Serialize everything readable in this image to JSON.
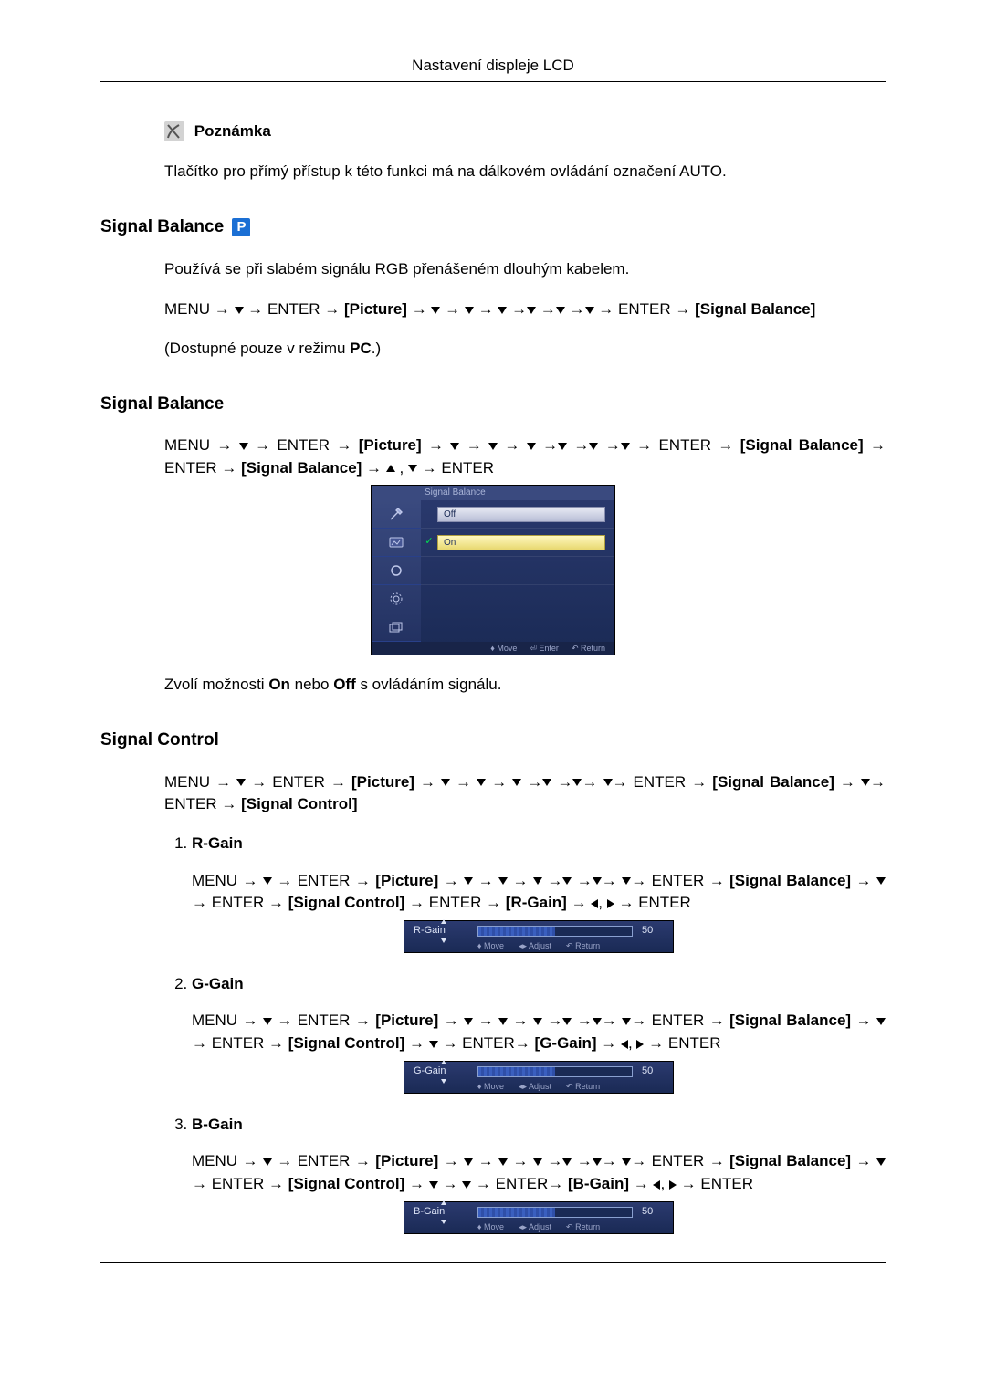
{
  "page_title": "Nastavení displeje LCD",
  "note": {
    "label": "Poznámka",
    "text": "Tlačítko pro přímý přístup k této funkci má na dálkovém ovládání označení AUTO."
  },
  "section1": {
    "heading": "Signal Balance",
    "badge": "P",
    "intro": "Používá se při slabém signálu RGB přenášeném dlouhým kabelem.",
    "path_prefix": "MENU → ",
    "path_enter1": " → ENTER → ",
    "path_picture": "[Picture]",
    "path_mid": " → ",
    "path_enter2": " → ENTER → ",
    "path_sb": "[Signal Balance]",
    "avail_prefix": "(Dostupné pouze v režimu ",
    "avail_mode": "PC",
    "avail_suffix": ".)"
  },
  "section2": {
    "heading": "Signal Balance",
    "path_prefix": "MENU → ",
    "path_enter1": " → ENTER → ",
    "path_picture": "[Picture]",
    "path_mid": " → ",
    "path_enter2": " → ENTER → ",
    "path_sb": "[Signal Balance]",
    "path_after_sb": " → ENTER → ",
    "path_sb2": "[Signal Balance]",
    "path_tail": " → ENTER",
    "osd": {
      "title": "Signal Balance",
      "off": "Off",
      "on": "On",
      "footer_move": "Move",
      "footer_enter": "Enter",
      "footer_return": "Return"
    },
    "desc_prefix": "Zvolí možnosti ",
    "desc_on": "On",
    "desc_mid": " nebo ",
    "desc_off": "Off",
    "desc_suffix": " s ovládáním signálu."
  },
  "section3": {
    "heading": "Signal Control",
    "path_prefix": "MENU → ",
    "path_enter1": " → ENTER → ",
    "path_picture": "[Picture]",
    "path_mid": " → ",
    "path_enter2": " ENTER → ",
    "path_sb": "[Signal Balance]",
    "path_after": " → ",
    "path_enter3": "→ ENTER → ",
    "path_sc": "[Signal Control]",
    "items": [
      {
        "title": "R-Gain",
        "pre": "MENU → ",
        "enter1": " → ENTER → ",
        "picture": "[Picture]",
        "mid": " → ",
        "enter2": " ENTER → ",
        "sb": "[Signal Balance]",
        "after_sb": " → ",
        "enter3": "→ ENTER → ",
        "sc": "[Signal Control]",
        "after_sc": " → ENTER → ",
        "gain": "[R-Gain]",
        "tail": " → ENTER",
        "slider_label": "R-Gain",
        "slider_value": "50",
        "footer_move": "Move",
        "footer_adjust": "Adjust",
        "footer_return": "Return"
      },
      {
        "title": "G-Gain",
        "pre": "MENU → ",
        "enter1": " → ENTER → ",
        "picture": "[Picture]",
        "mid": " → ",
        "enter2": " ENTER → ",
        "sb": "[Signal Balance]",
        "after_sb": " → ",
        "enter3": "→ ENTER → ",
        "sc": "[Signal Control]",
        "after_sc": " → ",
        "enter4": " → ENTER→ ",
        "gain": "[G-Gain]",
        "tail": " → ENTER",
        "slider_label": "G-Gain",
        "slider_value": "50",
        "footer_move": "Move",
        "footer_adjust": "Adjust",
        "footer_return": "Return"
      },
      {
        "title": "B-Gain",
        "pre": "MENU → ",
        "enter1": " → ENTER → ",
        "picture": "[Picture]",
        "mid": " → ",
        "enter2": " ENTER → ",
        "sb": "[Signal Balance]",
        "after_sb": " → ",
        "enter3": "→ ENTER → ",
        "sc": "[Signal Control]",
        "after_sc": " → ",
        "enter4": " → ENTER→ ",
        "gain": "[B-Gain]",
        "tail": " → ENTER",
        "slider_label": "B-Gain",
        "slider_value": "50",
        "footer_move": "Move",
        "footer_adjust": "Adjust",
        "footer_return": "Return"
      }
    ]
  }
}
